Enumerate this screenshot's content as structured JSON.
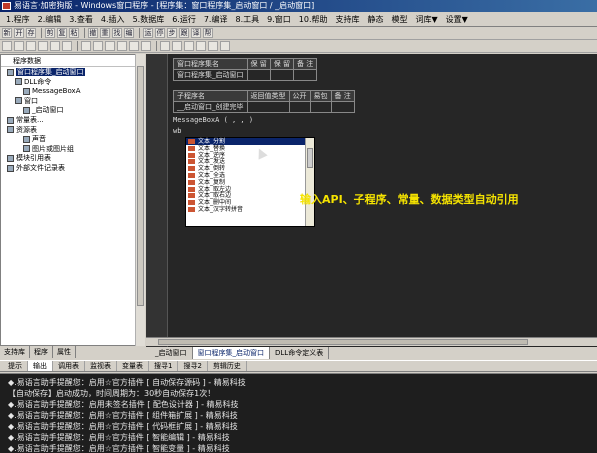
{
  "window": {
    "title": "易语言·加密狗版 - Windows窗口程序 - [程序集：窗口程序集_启动窗口 / _启动窗口]"
  },
  "menu": [
    "1.程序",
    "2.编辑",
    "3.查看",
    "4.插入",
    "5.数据库",
    "6.运行",
    "7.编译",
    "8.工具",
    "9.窗口",
    "10.帮助",
    "支持库",
    "静态",
    "模型",
    "词库▼",
    "设置▼"
  ],
  "tree": {
    "header": "程序数据",
    "items": [
      {
        "label": "窗口程序集_启动窗口",
        "selected": true
      },
      {
        "label": "DLL命令"
      },
      {
        "label": "MessageBoxA"
      },
      {
        "label": "窗口"
      },
      {
        "label": "_启动窗口"
      },
      {
        "label": "常量表..."
      },
      {
        "label": "资源表"
      },
      {
        "label": "声音"
      },
      {
        "label": "图片或图片组"
      },
      {
        "label": "模块引用表"
      },
      {
        "label": "外部文件记录表"
      }
    ]
  },
  "left_tabs": [
    "支持库",
    "程序",
    "属性"
  ],
  "class_table": {
    "headers": [
      "窗口程序集名",
      "保 留",
      "保 留",
      "备 注"
    ],
    "row": [
      "窗口程序集_启动窗口",
      "",
      "",
      ""
    ]
  },
  "sub_table": {
    "headers": [
      "子程序名",
      "返回值类型",
      "公开",
      "易包",
      "备 注"
    ],
    "row": [
      "__启动窗口_创建完毕",
      "",
      "",
      "",
      ""
    ]
  },
  "code": {
    "line1": "MessageBoxA ( , , )",
    "line2": "wb"
  },
  "autocomplete": [
    "文本_分割",
    "文本_替换",
    "文本_逆序",
    "文本_发送",
    "文本_倒转",
    "文本_全选",
    "文本_复制",
    "文本_取左边",
    "文本_取右边",
    "文本_删中间",
    "文本_汉字转拼音"
  ],
  "caption": "输入API、子程序、常量、数据类型自动引用",
  "editor_tabs": [
    "_启动窗口",
    "窗口程序集_启动窗口",
    "DLL命令定义表"
  ],
  "output_tabs": [
    "提示",
    "输出",
    "调用表",
    "监视表",
    "变量表",
    "搜寻1",
    "搜寻2",
    "剪辑历史"
  ],
  "output_lines": [
    "◆.易语言助手提醒您：启用☆官方插件 [ 自动保存源码 ] - 精易科技",
    "【自动保存】启动成功，时间周期为：30秒自动保存1次！",
    "◆.易语言助手提醒您：启用未签名插件 [ 配色设计器 ] - 精易科技",
    "◆.易语言助手提醒您：启用☆官方插件 [ 组件箱扩展 ] - 精易科技",
    "◆.易语言助手提醒您：启用☆官方插件 [ 代码框扩展 ] - 精易科技",
    "◆.易语言助手提醒您：启用☆官方插件 [ 智能编辑 ] - 精易科技",
    "◆.易语言助手提醒您：启用☆官方插件 [ 智能变量 ] - 精易科技"
  ],
  "colors": {
    "caption": "#f5e300",
    "editor_bg": "#262626",
    "output_bg": "#1e1e1e",
    "title_bg": "#0a246a"
  }
}
